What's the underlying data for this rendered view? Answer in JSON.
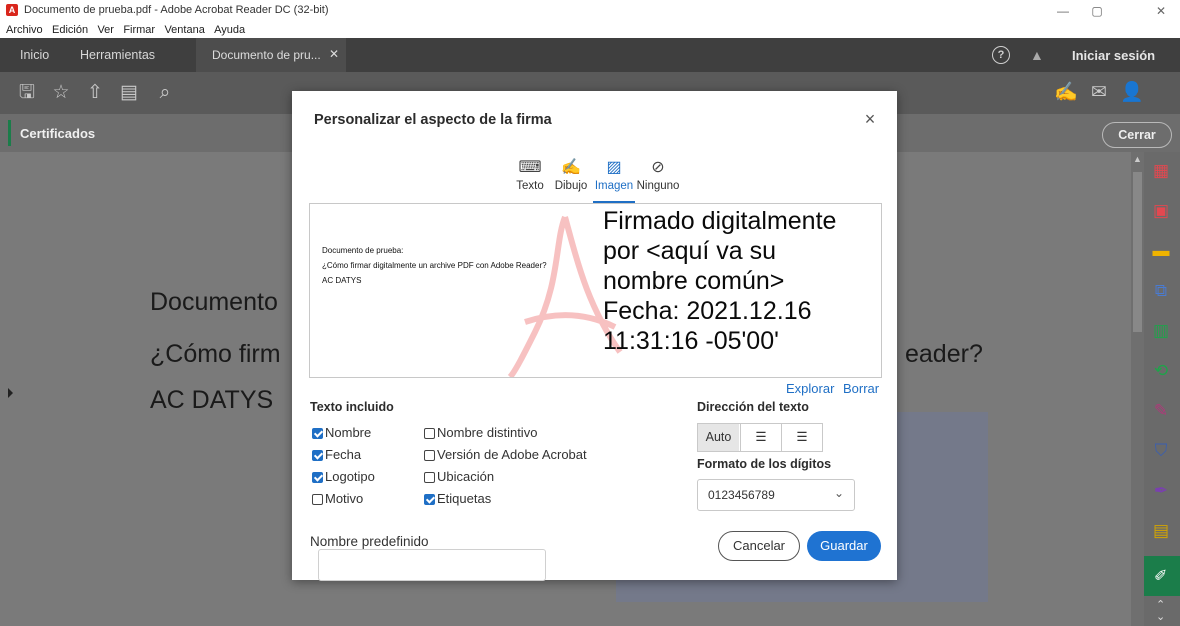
{
  "window": {
    "title": "Documento de prueba.pdf - Adobe Acrobat Reader DC (32-bit)"
  },
  "menu": [
    "Archivo",
    "Edición",
    "Ver",
    "Firmar",
    "Ventana",
    "Ayuda"
  ],
  "tabs": {
    "home": "Inicio",
    "tools": "Herramientas",
    "doc": "Documento de pru..."
  },
  "signin": "Iniciar sesión",
  "certbar": {
    "label": "Certificados",
    "close": "Cerrar"
  },
  "document": {
    "line1": "Documento",
    "line2": "¿Cómo firm",
    "line2_right": "eader?",
    "line3": "AC DATYS"
  },
  "dialog": {
    "title": "Personalizar el aspecto de la firma",
    "tabs": {
      "texto": "Texto",
      "dibujo": "Dibujo",
      "imagen": "Imagen",
      "ninguno": "Ninguno"
    },
    "preview": {
      "small1": "Documento de prueba:",
      "small2": "¿Cómo firmar digitalmente un archive PDF con Adobe Reader?",
      "small3": "AC DATYS",
      "big1": "Firmado digitalmente",
      "big2": "por <aquí va su",
      "big3": "nombre común>",
      "big4": "Fecha: 2021.12.16",
      "big5": "11:31:16 -05'00'"
    },
    "links": {
      "explorar": "Explorar",
      "borrar": "Borrar"
    },
    "texto_incluido": "Texto incluido",
    "checks": {
      "nombre": "Nombre",
      "fecha": "Fecha",
      "logotipo": "Logotipo",
      "motivo": "Motivo",
      "nombre_distintivo": "Nombre distintivo",
      "version": "Versión de Adobe Acrobat",
      "ubicacion": "Ubicación",
      "etiquetas": "Etiquetas"
    },
    "direccion": "Dirección del texto",
    "dir_auto": "Auto",
    "formato": "Formato de los dígitos",
    "digits_value": "0123456789",
    "nombre_predefinido": "Nombre predefinido",
    "cancel": "Cancelar",
    "save": "Guardar"
  },
  "colors": {
    "accent": "#1f73d2",
    "toolbar": "#5a5a5a"
  }
}
